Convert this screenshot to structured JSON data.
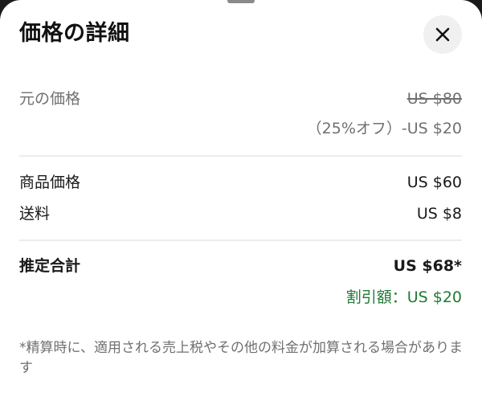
{
  "sheet": {
    "title": "価格の詳細",
    "close_icon": "close-icon"
  },
  "original_price": {
    "label": "元の価格",
    "value": "US $80",
    "discount_text": "（25%オフ）-US $20"
  },
  "item_price": {
    "label": "商品価格",
    "value": "US $60"
  },
  "shipping": {
    "label": "送料",
    "value": "US $8"
  },
  "total": {
    "label": "推定合計",
    "value": "US $68*",
    "savings_text": "割引額：US $20"
  },
  "footnote": "*精算時に、適用される売上税やその他の料金が加算される場合があります",
  "colors": {
    "savings_green": "#1e7b34",
    "muted_text": "#707070",
    "close_button_bg": "#f0f0f0"
  }
}
